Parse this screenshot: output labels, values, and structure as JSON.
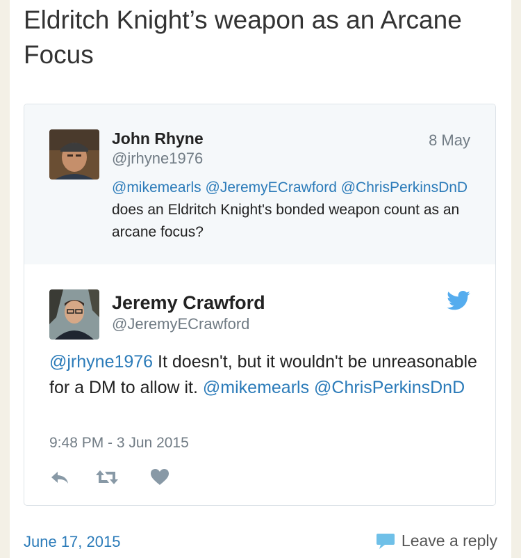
{
  "post": {
    "title": "Eldritch Knight’s weapon as an Arcane Focus",
    "date": "June 17, 2015",
    "reply_label": "Leave a reply"
  },
  "quoted_tweet": {
    "name": "John Rhyne",
    "handle": "@jrhyne1976",
    "date": "8 May",
    "mention_1": "@mikemearls",
    "mention_2": "@JeremyECrawford",
    "mention_3": "@ChrisPerkinsDnD",
    "text": "does an Eldritch Knight's bonded weapon count as an arcane focus?"
  },
  "reply_tweet": {
    "name": "Jeremy Crawford",
    "handle": "@JeremyECrawford",
    "mention_1": "@jrhyne1976",
    "text": "It doesn't, but it wouldn't be unreasonable for a DM to allow it.",
    "mention_2": "@mikemearls",
    "mention_3": "@ChrisPerkinsDnD",
    "timestamp": "9:48 PM - 3 Jun 2015"
  },
  "icons": {
    "brand": "twitter-bird-icon",
    "reply": "reply-arrow-icon",
    "retweet": "retweet-icon",
    "like": "heart-icon",
    "comment": "speech-bubble-icon"
  },
  "colors": {
    "link": "#2b7bb9",
    "twitter_blue": "#55acee",
    "quoted_bg": "#f5f8fa",
    "action_gray": "#8899a6",
    "page_bg": "#f3f0e6"
  }
}
